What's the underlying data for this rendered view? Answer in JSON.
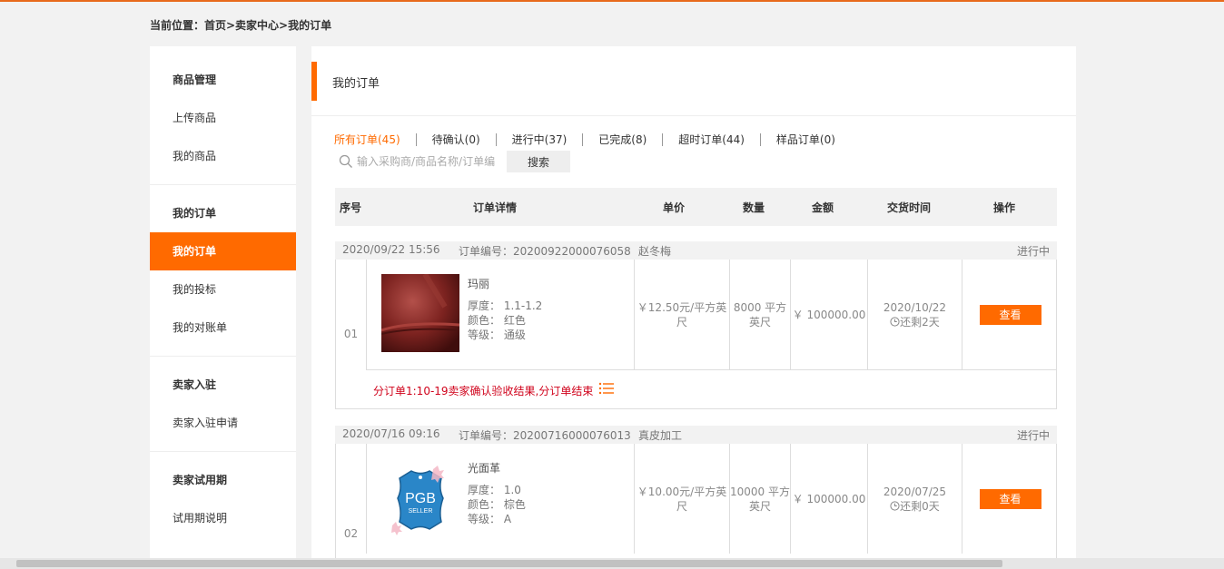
{
  "breadcrumb": "当前位置：首页>卖家中心>我的订单",
  "sidebar": {
    "groups": [
      {
        "head": "商品管理",
        "items": [
          "上传商品",
          "我的商品"
        ]
      },
      {
        "head": "我的订单",
        "items": [
          "我的订单",
          "我的投标",
          "我的对账单"
        ]
      },
      {
        "head": "卖家入驻",
        "items": [
          "卖家入驻申请"
        ]
      },
      {
        "head": "卖家试用期",
        "items": [
          "试用期说明"
        ]
      }
    ],
    "active": "我的订单"
  },
  "main": {
    "title": "我的订单",
    "tabs": [
      "所有订单(45)",
      "待确认(0)",
      "进行中(37)",
      "已完成(8)",
      "超时订单(44)",
      "样品订单(0)"
    ],
    "search": {
      "placeholder": "输入采购商/商品名称/订单编",
      "button": "搜索"
    },
    "columns": [
      "序号",
      "订单详情",
      "单价",
      "数量",
      "金额",
      "交货时间",
      "操作"
    ],
    "orders": [
      {
        "date": "2020/09/22 15:56",
        "order_no": "订单编号：20200922000076058",
        "buyer": "赵冬梅",
        "status": "进行中",
        "index": "01",
        "product": "玛丽",
        "thickness": "厚度： 1.1-1.2",
        "color": "颜色： 红色",
        "grade": "等级： 通级",
        "price": "￥12.50元/平方英尺",
        "qty": "8000 平方英尺",
        "amount": "￥ 100000.00",
        "delivery": "2020/10/22",
        "remaining": "还剩2天",
        "action": "查看",
        "sub_order": "分订单1:10-19卖家确认验收结果,分订单结束"
      },
      {
        "date": "2020/07/16 09:16",
        "order_no": "订单编号：20200716000076013",
        "buyer": "真皮加工",
        "status": "进行中",
        "index": "02",
        "product": "光面革",
        "thickness": "厚度： 1.0",
        "color": "颜色： 棕色",
        "grade": "等级： A",
        "price": "￥10.00元/平方英尺",
        "qty": "10000 平方英尺",
        "amount": "￥ 100000.00",
        "delivery": "2020/07/25",
        "remaining": "还剩0天",
        "action": "查看",
        "logo_text": "PGB",
        "logo_sub": "SELLER"
      }
    ]
  },
  "colors": {
    "accent": "#ff6a00",
    "alert": "#d0021b"
  }
}
